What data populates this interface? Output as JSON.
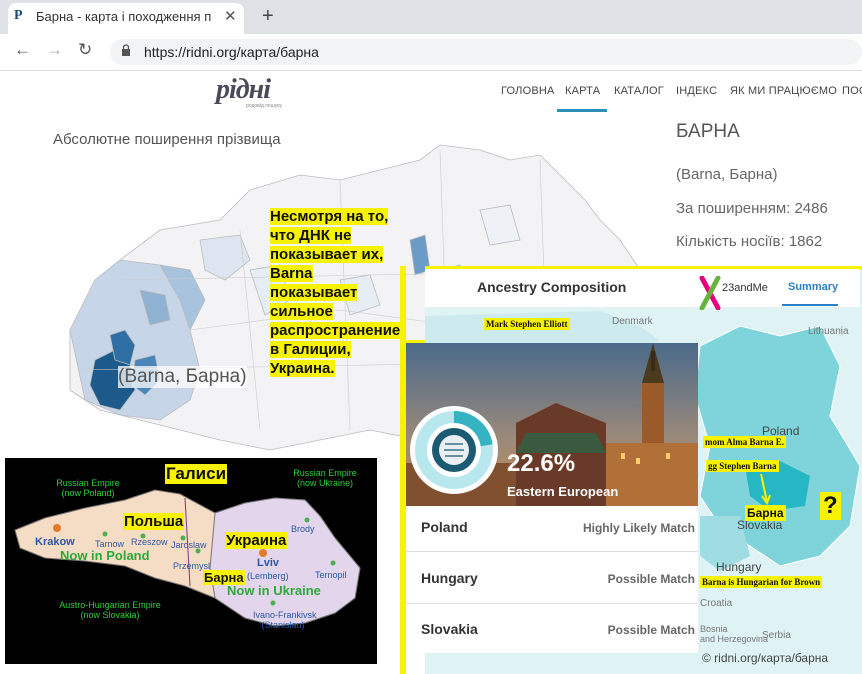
{
  "browser": {
    "tab_title": "Барна - карта і походження прі",
    "favicon": "Р",
    "close": "✕",
    "new_tab": "+",
    "back": "←",
    "forward": "→",
    "reload": "↻",
    "lock": "🔒",
    "url": "https://ridni.org/карта/барна"
  },
  "site": {
    "logo": "рідні",
    "logo_sub": "родовід пошуку",
    "nav": [
      "ГОЛОВНА",
      "КАРТА",
      "КАТАЛОГ",
      "ІНДЕКС",
      "ЯК МИ ПРАЦЮЄМО",
      "ПОС"
    ],
    "active_nav": "КАРТА"
  },
  "map": {
    "heading": "Абсолютне поширення прізвища",
    "label": "(Barna, Барна)",
    "note": "Несмотря на то, что ДНК не показывает их, Barna показывает сильное распространение в Галиции, Украина."
  },
  "info": {
    "name": "БАРНА",
    "variants": "(Barna, Барна)",
    "spread": "За поширенням: 2486",
    "carriers": "Кількість носіїв:  1862"
  },
  "galicia": {
    "title": "Галиси",
    "russian_empire_poland": "Russian Empire\n(now Poland)",
    "russian_empire_ukraine": "Russian Empire\n(now Ukraine)",
    "austro": "Austro-Hungarian Empire\n(now Slovakia)",
    "poland": "Польша",
    "ukraine": "Украина",
    "barna": "Барна",
    "now_poland": "Now in Poland",
    "now_ukraine": "Now in Ukraine",
    "cities": [
      "Krakow",
      "Tarnow",
      "Rzeszow",
      "Jaroslaw",
      "Przemysl",
      "Brody",
      "Lviv",
      "(Lemberg)",
      "Ternopil",
      "Ivano-Frankivsk\n(Stanislau)"
    ]
  },
  "ancestry": {
    "title": "Ancestry Composition",
    "brand": "23andMe",
    "summary": "Summary",
    "user_label": "Mark Stephen Elliott",
    "percent": "22.6%",
    "population": "Eastern European",
    "rows": [
      {
        "country": "Poland",
        "match": "Highly Likely Match"
      },
      {
        "country": "Hungary",
        "match": "Possible Match"
      },
      {
        "country": "Slovakia",
        "match": "Possible Match"
      }
    ],
    "map_labels": {
      "denmark": "Denmark",
      "lithuania": "Lithuania",
      "poland": "Poland",
      "slovakia": "Slovakia",
      "hungary": "Hungary",
      "croatia": "Croatia",
      "bosnia": "Bosnia\nand Herzegovina",
      "serbia": "Serbia"
    },
    "notes": {
      "mom": "mom Alma Barna E.",
      "gg": "gg Stephen Barna",
      "barna": "Барна",
      "question": "?",
      "hungarian": "Barna is Hungarian for Brown"
    }
  },
  "copyright": "© ridni.org/карта/барна",
  "colors": {
    "accent": "#2b8fb8",
    "highlight": "#f7f200",
    "map_dark": "#1d5a8c",
    "teal": "#38c6d0"
  }
}
